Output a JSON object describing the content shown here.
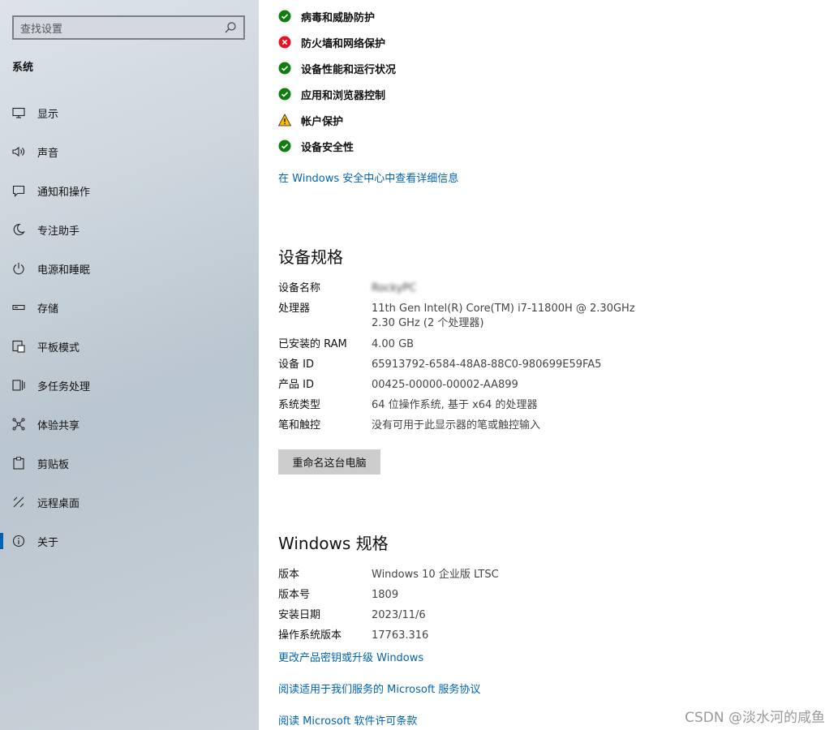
{
  "sidebar": {
    "search_placeholder": "查找设置",
    "section_title": "系统",
    "items": [
      {
        "label": "显示",
        "icon": "monitor-icon"
      },
      {
        "label": "声音",
        "icon": "speaker-icon"
      },
      {
        "label": "通知和操作",
        "icon": "notification-icon"
      },
      {
        "label": "专注助手",
        "icon": "moon-icon"
      },
      {
        "label": "电源和睡眠",
        "icon": "power-icon"
      },
      {
        "label": "存储",
        "icon": "storage-icon"
      },
      {
        "label": "平板模式",
        "icon": "tablet-icon"
      },
      {
        "label": "多任务处理",
        "icon": "multitask-icon"
      },
      {
        "label": "体验共享",
        "icon": "share-icon"
      },
      {
        "label": "剪贴板",
        "icon": "clipboard-icon"
      },
      {
        "label": "远程桌面",
        "icon": "remote-icon"
      },
      {
        "label": "关于",
        "icon": "info-icon"
      }
    ],
    "active_item": "关于"
  },
  "security": {
    "items": [
      {
        "label": "病毒和威胁防护",
        "status": "ok"
      },
      {
        "label": "防火墙和网络保护",
        "status": "error"
      },
      {
        "label": "设备性能和运行状况",
        "status": "ok"
      },
      {
        "label": "应用和浏览器控制",
        "status": "ok"
      },
      {
        "label": "帐户保护",
        "status": "warning"
      },
      {
        "label": "设备安全性",
        "status": "ok"
      }
    ],
    "details_link": "在 Windows 安全中心中查看详细信息",
    "colors": {
      "ok": "#107c10",
      "error": "#e81123",
      "warning": "#ffb900"
    }
  },
  "device_specs": {
    "title": "设备规格",
    "rows": [
      {
        "key": "设备名称",
        "value": "RockyPC"
      },
      {
        "key": "处理器",
        "value": "11th Gen Intel(R) Core(TM) i7-11800H @ 2.30GHz",
        "value2": "2.30 GHz  (2 个处理器)"
      },
      {
        "key": "已安装的 RAM",
        "value": "4.00 GB"
      },
      {
        "key": "设备 ID",
        "value": "65913792-6584-48A8-88C0-980699E59FA5"
      },
      {
        "key": "产品 ID",
        "value": "00425-00000-00002-AA899"
      },
      {
        "key": "系统类型",
        "value": "64 位操作系统, 基于 x64 的处理器"
      },
      {
        "key": "笔和触控",
        "value": "没有可用于此显示器的笔或触控输入"
      }
    ],
    "rename_button": "重命名这台电脑"
  },
  "windows_specs": {
    "title": "Windows 规格",
    "rows": [
      {
        "key": "版本",
        "value": "Windows 10 企业版 LTSC"
      },
      {
        "key": "版本号",
        "value": "1809"
      },
      {
        "key": "安装日期",
        "value": "2023/11/6"
      },
      {
        "key": "操作系统版本",
        "value": "17763.316"
      }
    ],
    "links": [
      "更改产品密钥或升级 Windows",
      "阅读适用于我们服务的 Microsoft 服务协议",
      "阅读 Microsoft 软件许可条款"
    ]
  },
  "watermark": "CSDN @淡水河的咸鱼",
  "accent_color": "#0063b1"
}
